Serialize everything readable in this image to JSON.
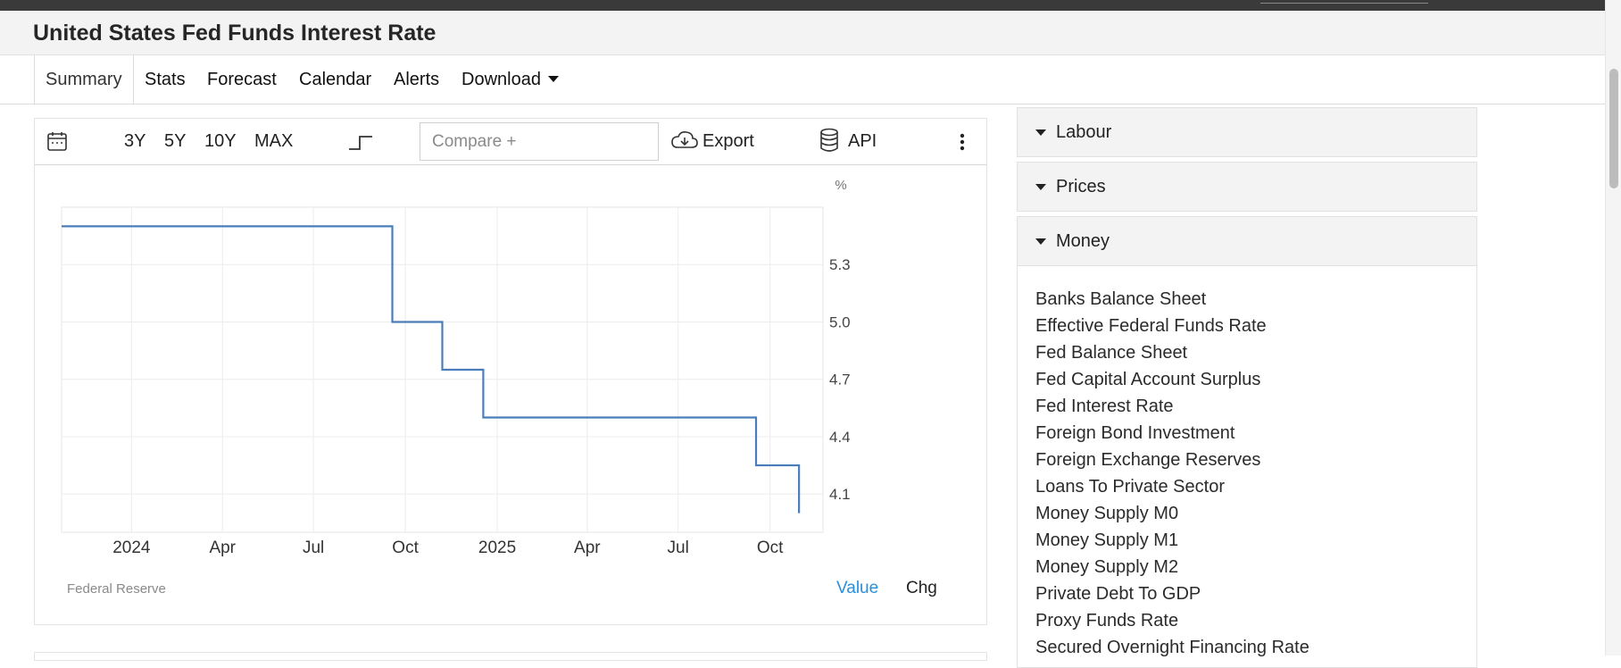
{
  "page": {
    "title": "United States Fed Funds Interest Rate"
  },
  "tabs": [
    {
      "label": "Summary",
      "active": true
    },
    {
      "label": "Stats"
    },
    {
      "label": "Forecast"
    },
    {
      "label": "Calendar"
    },
    {
      "label": "Alerts"
    },
    {
      "label": "Download"
    }
  ],
  "toolbar": {
    "calendar_icon": "calendar-icon",
    "ranges": [
      "3Y",
      "5Y",
      "10Y",
      "MAX"
    ],
    "chart_type_icon": "step-chart-icon",
    "compare_placeholder": "Compare +",
    "export_label": "Export",
    "export_icon": "cloud-download-icon",
    "api_label": "API",
    "api_icon": "database-icon",
    "more_icon": "more-vertical-icon"
  },
  "chart_data": {
    "type": "line",
    "style": "step",
    "unit_label": "%",
    "x_ticks": [
      "2024",
      "Apr",
      "Jul",
      "Oct",
      "2025",
      "Apr",
      "Jul",
      "Oct"
    ],
    "y_ticks": [
      "5.3",
      "5.0",
      "4.7",
      "4.4",
      "4.1"
    ],
    "ylim": [
      3.9,
      5.6
    ],
    "xlim": [
      "2023-10-23",
      "2025-11-23"
    ],
    "grid": true,
    "series": [
      {
        "color": "#4a7ebb",
        "x": [
          "2023-10-23",
          "2024-09-18",
          "2024-11-07",
          "2024-12-18",
          "2025-09-17",
          "2025-10-29",
          "2025-10-30"
        ],
        "y": [
          5.5,
          5.0,
          4.75,
          4.5,
          4.25,
          4.25,
          4.0
        ]
      }
    ]
  },
  "footer": {
    "source": "Federal Reserve",
    "value_label": "Value",
    "chg_label": "Chg"
  },
  "sidebar": {
    "sections": [
      {
        "label": "Labour",
        "expanded": false
      },
      {
        "label": "Prices",
        "expanded": false
      },
      {
        "label": "Money",
        "expanded": true
      }
    ],
    "money_items": [
      "Banks Balance Sheet",
      "Effective Federal Funds Rate",
      "Fed Balance Sheet",
      "Fed Capital Account Surplus",
      "Fed Interest Rate",
      "Foreign Bond Investment",
      "Foreign Exchange Reserves",
      "Loans To Private Sector",
      "Money Supply M0",
      "Money Supply M1",
      "Money Supply M2",
      "Private Debt To GDP",
      "Proxy Funds Rate",
      "Secured Overnight Financing Rate"
    ]
  },
  "colors": {
    "accent": "#2a8fdb",
    "line": "#4a7ebb",
    "header_bg": "#f3f3f3",
    "topbar_bg": "#3a3a3a"
  }
}
